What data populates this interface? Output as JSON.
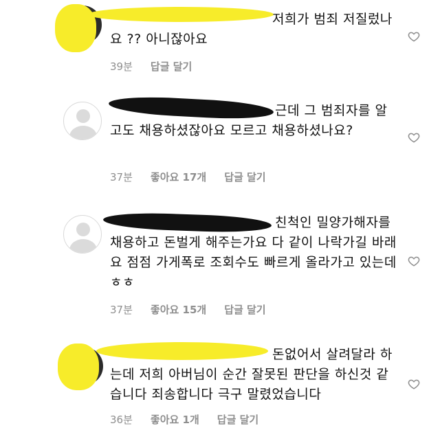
{
  "comments": [
    {
      "text": "저희가 범죄 저질렀나요 ?? 아니잖아요",
      "time": "39분",
      "likes": "",
      "reply": "답글 달기"
    },
    {
      "text": "근데 그 범죄자를 알고도 채용하셨잖아요 모르고 채용하셨나요?",
      "time": "37분",
      "likes": "좋아요 17개",
      "reply": "답글 달기"
    },
    {
      "text": "친척인 밀양가해자를 채용하고 돈벌게 해주는가요 다 같이 나락가길 바래요 점점 가게폭로 조회수도 빠르게 올라가고 있는데 ㅎㅎ",
      "time": "37분",
      "likes": "좋아요 15개",
      "reply": "답글 달기"
    },
    {
      "text": "돈없어서 살려달라 하는데 저희 아버님이 순간 잘못된 판단을 하신것 같습니다 죄송합니다 극구 말렸었습니다",
      "time": "36분",
      "likes": "좋아요 1개",
      "reply": "답글 달기"
    }
  ],
  "icons": {
    "like": "heart-outline-icon",
    "avatar": "default-avatar-icon"
  },
  "colors": {
    "meta": "#8e8e8e",
    "redaction_yellow": "#f7ec2a",
    "redaction_black": "#111111"
  }
}
